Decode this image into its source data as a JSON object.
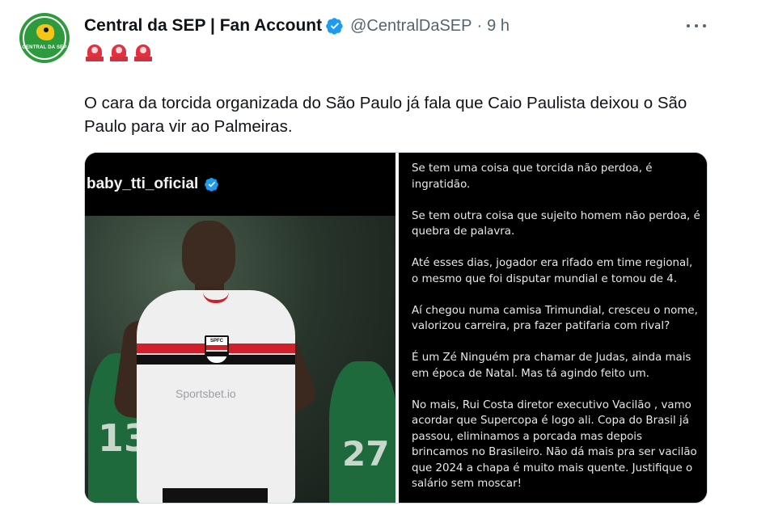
{
  "author": {
    "name": "Central da SEP | Fan Account",
    "handle": "@CentralDaSEP",
    "separator": "·",
    "time": "9 h",
    "avatar_text": "CENTRAL DA SEP"
  },
  "icons": {
    "verified": "verified-badge-icon",
    "more": "more-options-icon",
    "siren": "police-siren-emoji"
  },
  "colors": {
    "verified_blue": "#1d9bf0",
    "text_primary": "#0f1419",
    "text_secondary": "#536471",
    "siren_red": "#e33040"
  },
  "tweet": {
    "emojis": [
      "🚨",
      "🚨",
      "🚨"
    ],
    "text": "O cara da torcida organizada do São Paulo já fala que Caio Paulista deixou o São Paulo para vir ao Palmeiras."
  },
  "media": {
    "instagram_username": "baby_tti_oficial",
    "photo": {
      "sponsor": "Sportsbet.io",
      "crest": "SPFC",
      "bg_numbers": [
        "13",
        "27"
      ]
    },
    "caption_paragraphs": [
      "Se tem uma coisa que torcida não perdoa, é ingratidão.",
      "Se tem outra coisa que sujeito homem não perdoa, é quebra de palavra.",
      "Até esses dias, jogador era rifado em time regional, o mesmo que foi disputar mundial e tomou de 4.",
      "Aí chegou numa camisa Trimundial, cresceu o nome, valorizou carreira, pra fazer patifaria com rival?",
      "É um Zé Ninguém pra chamar de Judas, ainda mais em época de Natal. Mas tá agindo feito um.",
      "No mais, Rui Costa diretor executivo Vacilão , vamo acordar que Supercopa é logo ali. Copa do Brasil já passou, eliminamos a porcada mas depois brincamos no Brasileiro. Não dá mais pra ser vacilão que 2024 a chapa é muito mais quente. Justifique o salário sem moscar!"
    ]
  }
}
